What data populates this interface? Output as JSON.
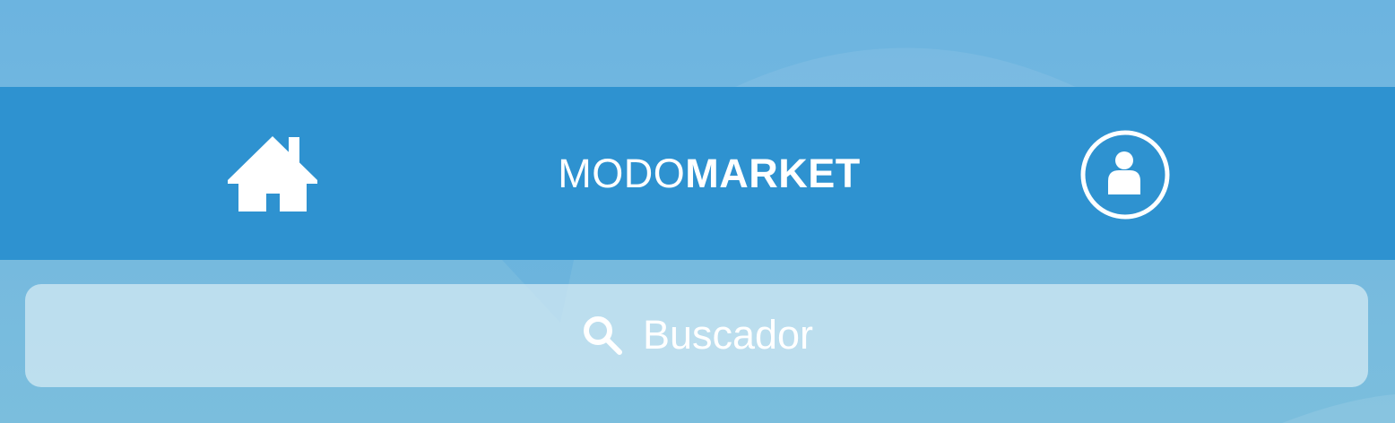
{
  "header": {
    "home_icon": "home-icon",
    "brand_light": "MODO",
    "brand_bold": "MARKET",
    "user_icon": "user-icon",
    "background_color": "#2e92d0"
  },
  "search": {
    "icon": "search-icon",
    "placeholder": "Buscador"
  },
  "colors": {
    "page_background": "#6cb4e0",
    "search_background": "#c0e0ee",
    "foreground": "#ffffff"
  }
}
